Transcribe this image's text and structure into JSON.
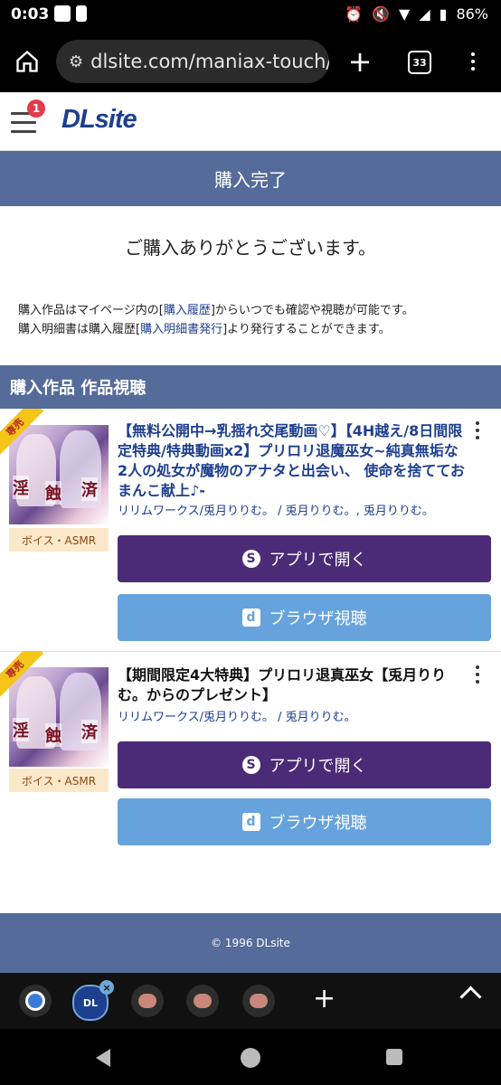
{
  "status_bar": {
    "time": "0:03",
    "battery": "86%"
  },
  "browser": {
    "url": "dlsite.com/maniax-touch/dc",
    "tab_count": "33"
  },
  "header": {
    "logo": "DLsite",
    "notification_count": "1"
  },
  "page": {
    "title": "購入完了",
    "thanks": "ご購入ありがとうございます。",
    "info1_before": "購入作品はマイページ内の[",
    "info1_link": "購入履歴",
    "info1_after": "]からいつでも確認や視聴が可能です。",
    "info2_before": "購入明細書は購入履歴[",
    "info2_link": "購入明細書発行",
    "info2_after": "]より発行することができます。",
    "section_title": "購入作品 作品視聴"
  },
  "products": [
    {
      "ribbon": "専売",
      "genre": "ボイス・ASMR",
      "title": "【無料公開中→乳揺れ交尾動画♡】【4H越え/8日間限定特典/特典動画x2】プリロリ退魔巫女~純真無垢な2人の処女が魔物のアナタと出会い、 使命を捨てておまんこ献上♪-",
      "circle": "リリムワークス/兎月りりむ。 / 兎月りりむ。, 兎月りりむ。",
      "open_app": "アプリで開く",
      "browser_view": "ブラウザ視聴"
    },
    {
      "ribbon": "専売",
      "genre": "ボイス・ASMR",
      "title": "【期間限定4大特典】プリロリ退真巫女【兎月りりむ。からのプレゼント】",
      "circle": "リリムワークス/兎月りりむ。 / 兎月りりむ。",
      "open_app": "アプリで開く",
      "browser_view": "ブラウザ視聴"
    }
  ],
  "footer": {
    "copyright": "© 1996 DLsite"
  },
  "tab_strip": {
    "tab2_label": "DL"
  }
}
